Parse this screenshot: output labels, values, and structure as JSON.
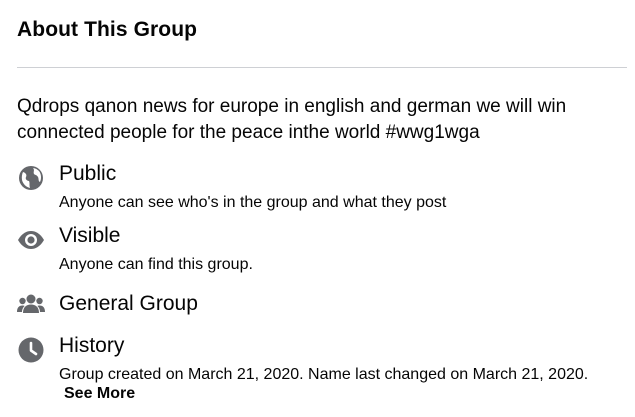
{
  "section": {
    "title": "About This Group",
    "description": "Qdrops qanon news for europe in english and german we will win connected people for the peace inthe world #wwg1wga"
  },
  "items": [
    {
      "icon": "globe-icon",
      "title": "Public",
      "subtitle": "Anyone can see who's in the group and what they post"
    },
    {
      "icon": "eye-icon",
      "title": "Visible",
      "subtitle": "Anyone can find this group."
    },
    {
      "icon": "people-icon",
      "title": "General Group",
      "subtitle": ""
    },
    {
      "icon": "clock-icon",
      "title": "History",
      "subtitle": "Group created on March 21, 2020. Name last changed on March 21, 2020."
    }
  ],
  "see_more": "See More",
  "colors": {
    "text": "#050505",
    "icon": "#65676b",
    "divider": "#ced0d4"
  }
}
